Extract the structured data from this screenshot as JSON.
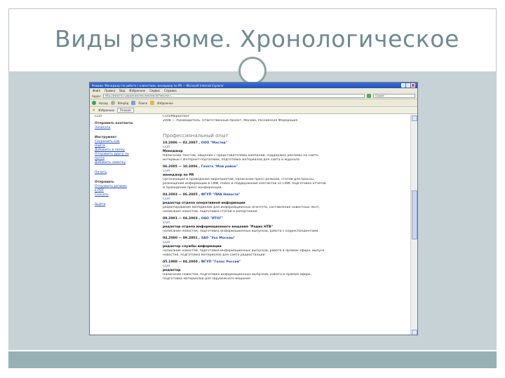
{
  "slide": {
    "title": "Виды резюме. Хронологическое"
  },
  "browser": {
    "window_title": "Резюме. Менеджер по работе с клиентами, менеджер по PR — Microsoft Internet Explorer",
    "menu": [
      "Файл",
      "Правка",
      "Вид",
      "Избранное",
      "Сервис",
      "Справка"
    ],
    "address_label": "Адрес",
    "address_value": "http://www.hh.ru/applicant/resumeview.do?resume=...",
    "search_value": "Google",
    "toolbar_items": [
      "Назад",
      "Вперёд",
      "Поиск",
      "Избранное"
    ],
    "favorites_label": "Избранное",
    "tab_label": "Резюме"
  },
  "sidebar": {
    "top_text": "СОЛ",
    "section1_head": "Отправить контакты",
    "section1_link": "Записать",
    "section2_head": "Инструмент",
    "section2_items": [
      "Сохранить как",
      "Найти",
      "Добавить в папку",
      "Отправить другу по",
      "почте",
      "Добавить заметку"
    ],
    "print_link": "Печать",
    "section3_head": "Отправить",
    "section3_items": [
      "Отправить резюме",
      "в PDF",
      "Скачать"
    ],
    "exit_link": "Выйти"
  },
  "main": {
    "header_line1": "СОЛ/Маркетинг",
    "header_line2": "2008 — Руководитель. Ответственный проект, Москва, Российская Федерация",
    "section_title": "Профессиональный опыт",
    "entries": [
      {
        "dates": "10.2006 — 02.2007",
        "company": "ООО \"Мастер\"",
        "city": "СОЛ",
        "position": "Менеджер",
        "desc1": "Написание текстов, общение с представителями компаний, поддержка рекламы на сайте,",
        "desc2": "интервью с Интернет-порталами, подготовка материалов для сайта и журнала"
      },
      {
        "dates": "06.2005 — 10.2006",
        "company": "Газета \"Мой район\"",
        "city": "СОЛ",
        "position": "менеджер по PR",
        "desc1": "Организация и проведение мероприятий, написание пресс-релизов, статей для прессы,",
        "desc2": "размещение информации в СМИ, поиск и поддержание контактов со СМИ, подготовка отчётов",
        "desc3": "и проведение пресс-конференций"
      },
      {
        "dates": "04.2003 — 06.2005",
        "company": "ФГУП \"ПИА Новости\"",
        "city": "СОЛ",
        "position": "редактор отдела оперативной информации",
        "desc1": "редактирование материалов для информационных агентств, составление новостных лент,",
        "desc2": "написание новостей, подготовка статей и репортажей"
      },
      {
        "dates": "09.2001 — 04.2003",
        "company": "ОАО \"ИТОГ\"",
        "city": "СОЛ",
        "position": "редактор отдела информационного вещания \"Радио НТВ\"",
        "desc1": "написание новостей, подготовка информационных выпусков, работа с корреспондентами"
      },
      {
        "dates": "04.2000 — 09.2001",
        "company": "ЗАО \"Эхо Москвы\"",
        "city": "СОЛ",
        "position": "редактор службы информации",
        "desc1": "написание новостей, подготовка информационных выпусков, работа в прямом эфире, выпуск",
        "desc2": "новостей, подготовка материалов для сайта радиостанции"
      },
      {
        "dates": "05.1998 — 04.2000",
        "company": "ФГУП \"Голос России\"",
        "city": "СОЛ",
        "position": "редактор",
        "desc1": "Написание новостей, подготовка информационных выпусков, работа в прямом эфире,",
        "desc2": "подготовка материалов для зарубежного вещания"
      }
    ]
  },
  "colors": {
    "title": "#6e8a90",
    "band": "#c6d2d6",
    "bottom_bar": "#97b0b3",
    "ring": "#8aa3a7",
    "link": "#1b47b5",
    "ie_titlebar": "#2352b8"
  }
}
